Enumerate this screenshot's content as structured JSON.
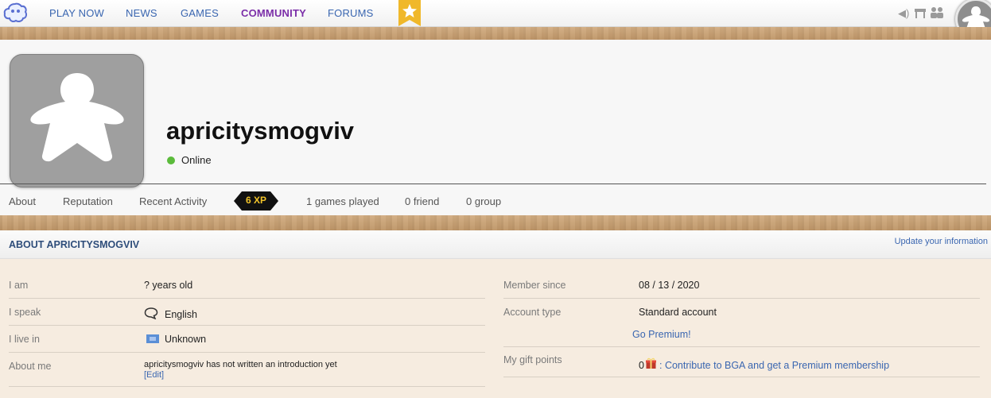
{
  "nav": {
    "items": [
      "PLAY NOW",
      "NEWS",
      "GAMES",
      "COMMUNITY",
      "FORUMS"
    ],
    "active": "COMMUNITY"
  },
  "colors": {
    "accent": "#7b2ea8",
    "link": "#3a66b0",
    "online": "#5bbb3b",
    "xp_gold": "#f3c52a"
  },
  "profile": {
    "name": "apricitysmogviv",
    "status": "Online",
    "tabs": [
      "About",
      "Reputation",
      "Recent Activity"
    ],
    "xp": "6 XP",
    "games_played": "1 games played",
    "friends": "0 friend",
    "groups": "0 group"
  },
  "about": {
    "title": "ABOUT APRICITYSMOGVIV",
    "update_link": "Update your information",
    "left": {
      "age_label": "I am",
      "age_value": "? years old",
      "speak_label": "I speak",
      "speak_value": "English",
      "live_label": "I live in",
      "live_value": "Unknown",
      "aboutme_label": "About me",
      "aboutme_value": "apricitysmogviv has not written an introduction yet",
      "edit_link": "[Edit]"
    },
    "right": {
      "member_label": "Member since",
      "member_value": "08 / 13 / 2020",
      "account_label": "Account type",
      "account_value": "Standard account",
      "premium_link": "Go Premium!",
      "gift_label": "My gift points",
      "gift_count": "0",
      "gift_link": ": Contribute to BGA and get a Premium membership"
    }
  },
  "icons": [
    "bga-logo-icon",
    "star-icon",
    "sound-icon",
    "table-icon",
    "people-icon",
    "meeple-icon",
    "chat-bubble-icon",
    "flag-icon",
    "gift-icon"
  ]
}
